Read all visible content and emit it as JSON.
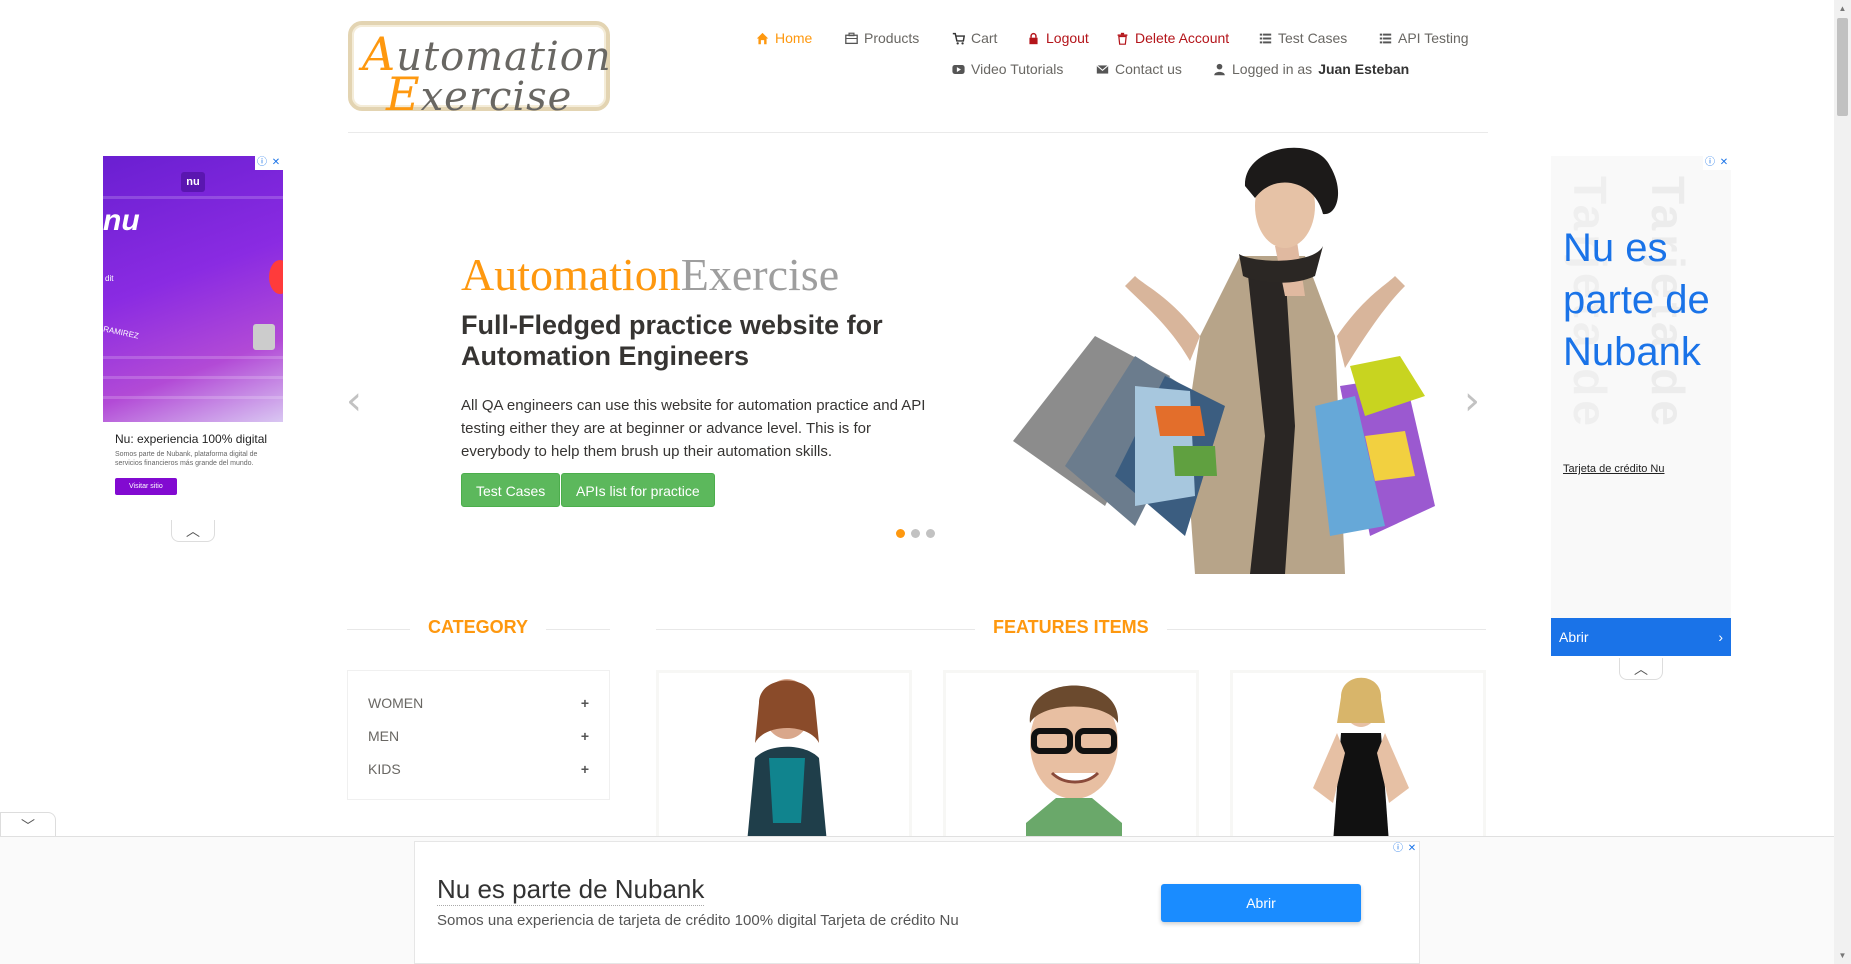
{
  "logo": {
    "line1": "Automation",
    "line2": "Exercise"
  },
  "nav": {
    "home": "Home",
    "products": "Products",
    "cart": "Cart",
    "logout": "Logout",
    "delete_account": "Delete Account",
    "test_cases": "Test Cases",
    "api_testing": "API Testing",
    "video_tutorials": "Video Tutorials",
    "contact_us": "Contact us",
    "logged_in_prefix": "Logged in as",
    "logged_in_user": "Juan Esteban"
  },
  "hero": {
    "brand_part1": "Automation",
    "brand_part2": "Exercise",
    "title": "Full-Fledged practice website for Automation Engineers",
    "description": "All QA engineers can use this website for automation practice and API testing either they are at beginner or advance level. This is for everybody to help them brush up their automation skills.",
    "btn_test_cases": "Test Cases",
    "btn_apis": "APIs list for practice",
    "active_slide": 1,
    "slide_count": 3
  },
  "category": {
    "title": "CATEGORY",
    "items": [
      {
        "label": "WOMEN",
        "icon": "plus-icon"
      },
      {
        "label": "MEN",
        "icon": "plus-icon"
      },
      {
        "label": "KIDS",
        "icon": "plus-icon"
      }
    ]
  },
  "features": {
    "title": "FEATURES ITEMS"
  },
  "ad_left": {
    "brand": "nu",
    "title": "Nu: experiencia 100% digital",
    "description": "Somos parte de Nubank, plataforma digital de servicios financieros más grande del mundo.",
    "button": "Visitar sitio",
    "card_name": "RAMIREZ",
    "card_word": "dit"
  },
  "ad_right": {
    "headline": "Nu es parte de Nubank",
    "subtitle": "Tarjeta de crédito Nu",
    "button": "Abrir",
    "bg_text": "Tarjeta de"
  },
  "ad_bottom": {
    "title": "Nu es parte de Nubank",
    "description": "Somos una experiencia de tarjeta de crédito 100% digital Tarjeta de crédito Nu",
    "button": "Abrir"
  },
  "ad_controls": {
    "info": "ⓘ",
    "close": "✕"
  },
  "colors": {
    "accent": "#fe980f",
    "green": "#5cb85c",
    "danger": "#b4141a",
    "ad_blue": "#1a73e8"
  }
}
